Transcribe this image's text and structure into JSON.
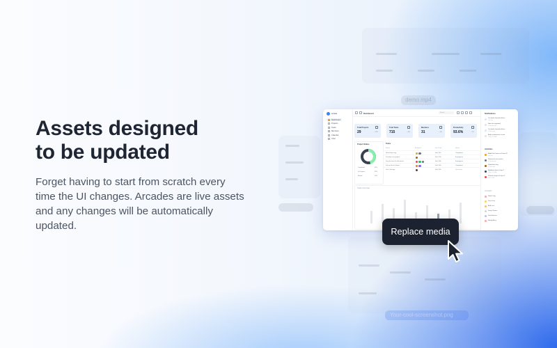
{
  "hero": {
    "title_line1": "Assets designed",
    "title_line2": "to be updated",
    "body": "Forget having to start from scratch every time the UI changes. Arcades are live assets and any changes will be automatically updated."
  },
  "background_labels": {
    "top_file": "demo.mp4",
    "bottom_file": "Your-cool-screenshot.png"
  },
  "dashboard": {
    "app_name": "Arcade",
    "page_title": "Dashboard",
    "search_placeholder": "Search",
    "nav": [
      {
        "label": "Dashboard",
        "icon": "home-icon"
      },
      {
        "label": "Projects",
        "icon": "folder-icon"
      },
      {
        "label": "Tasks",
        "icon": "check-icon"
      },
      {
        "label": "Members",
        "icon": "users-icon"
      },
      {
        "label": "Calendar",
        "icon": "calendar-icon"
      },
      {
        "label": "Chat",
        "icon": "chat-icon"
      }
    ],
    "stats": [
      {
        "label": "Total Projects",
        "value": "29",
        "change": "+ 12%"
      },
      {
        "label": "Total Tasks",
        "value": "715",
        "change": "+ 8%"
      },
      {
        "label": "Members",
        "value": "31",
        "change": "+ 4%"
      },
      {
        "label": "Productivity",
        "value": "93.6%",
        "change": "+ 2%"
      }
    ],
    "project_status": {
      "title": "Project Status",
      "completed_fraction": 0.45,
      "legend": [
        {
          "label": "Completed",
          "value": "45%"
        },
        {
          "label": "In Progress",
          "value": "35%"
        },
        {
          "label": "Behind",
          "value": "20%"
        }
      ]
    },
    "tasks": {
      "title": "Tasks",
      "headers": [
        "Name",
        "Assignee",
        "Due Date",
        "Status"
      ],
      "rows": [
        {
          "name": "Write blog copy",
          "date": "Feb 11th",
          "status": "Completed"
        },
        {
          "name": "Develop new graphic",
          "date": "Feb 12th",
          "status": "In progress"
        },
        {
          "name": "Key decision for document",
          "date": "Feb 14th",
          "status": "In progress"
        },
        {
          "name": "Set up Secret Santa",
          "date": "Feb 18th",
          "status": "Completed"
        },
        {
          "name": "Get a Garage",
          "date": "Feb 20th",
          "status": "Upcoming"
        }
      ]
    },
    "overview": {
      "title": "Tasks Overview"
    },
    "notifications": {
      "title": "Notifications",
      "items": [
        {
          "text": "You fixed a bug that affects...",
          "time": "Just now"
        },
        {
          "text": "New user registered",
          "time": "59 minutes ago"
        },
        {
          "text": "You fixed a bug that affects...",
          "time": "12 hours ago"
        },
        {
          "text": "Andy commented on a task",
          "time": "Today, 11:59 AM"
        }
      ]
    },
    "activities": {
      "title": "Activities",
      "items": [
        {
          "text": "Added the Feature to Project B",
          "time": "Just now"
        },
        {
          "text": "Released a new version",
          "time": "59 minutes ago"
        },
        {
          "text": "Submitted a bug",
          "time": "12 hours ago"
        },
        {
          "text": "Modified a data in Page X",
          "time": "Today, 11:59 AM"
        },
        {
          "text": "Deleted a page in Project X",
          "time": "Feb 2, 2024"
        }
      ]
    },
    "contacts": {
      "title": "Contacts",
      "items": [
        "Natali Craig",
        "Drew Cano",
        "Andi Lane",
        "Koray Okumus",
        "Kate Morrison",
        "Melody Macy"
      ]
    }
  },
  "replace_button": {
    "label": "Replace media"
  },
  "colors": {
    "accent": "#3b82f6",
    "tooltip_bg": "#1c2230",
    "stat_bg": "#e8f1fb",
    "donut_green": "#86efac",
    "donut_gray": "#374151"
  }
}
